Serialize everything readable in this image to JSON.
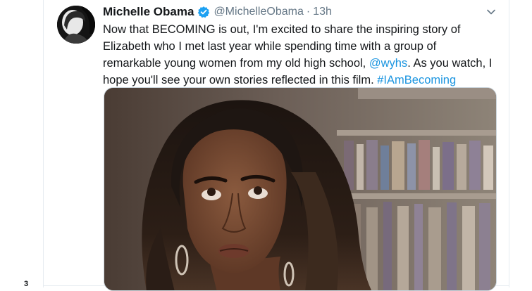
{
  "tweet": {
    "display_name": "Michelle Obama",
    "handle": "@MichelleObama",
    "separator": "·",
    "timestamp": "13h",
    "verified": true,
    "text_part1": "Now that BECOMING is out, I'm excited to share the inspiring story of Elizabeth who I met last year while spending time with a group of remarkable young women from my old high school, ",
    "mention": "@wyhs",
    "text_part2": ". As you watch, I hope you'll see your own stories reflected in this film. ",
    "hashtag": "#IAmBecoming"
  },
  "gutter": {
    "stray_mark": "3"
  },
  "colors": {
    "link": "#1b95e0",
    "verified": "#1da1f2",
    "secondary_text": "#657786",
    "border": "#e6ecf0"
  },
  "icons": {
    "verified": "verified-badge-icon",
    "caret": "chevron-down-icon"
  }
}
